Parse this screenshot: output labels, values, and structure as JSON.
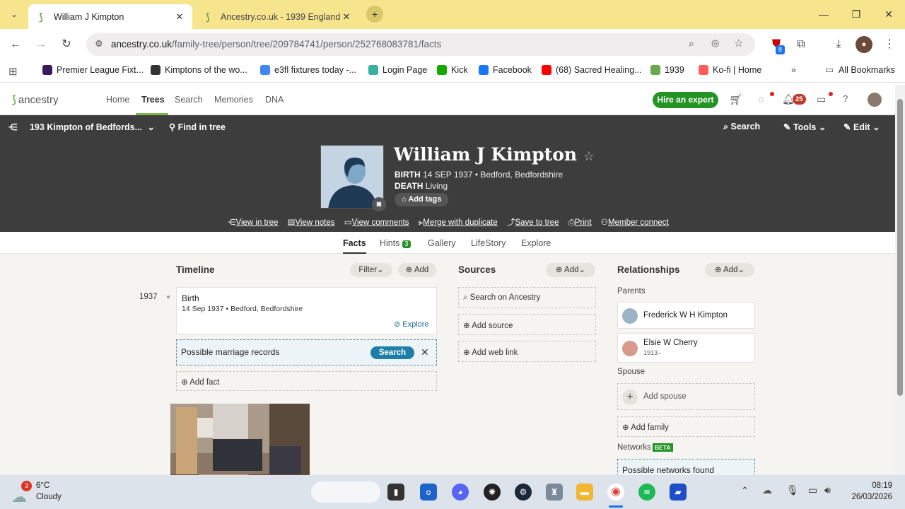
{
  "browser": {
    "tabs": [
      {
        "title": "William J Kimpton",
        "active": true
      },
      {
        "title": "Ancestry.co.uk - 1939 England &",
        "active": false
      }
    ],
    "url_domain": "ancestry.co.uk",
    "url_path": "/family-tree/person/tree/209784741/person/252768083781/facts",
    "extension_badge": "8",
    "bookmarks": [
      {
        "label": "Premier League Fixt...",
        "icon": "premier-league-icon",
        "color": "#3d195b"
      },
      {
        "label": "Kimptons of the wo...",
        "icon": "globe-icon",
        "color": "#333333"
      },
      {
        "label": "e3fl fixtures today -...",
        "icon": "google-icon",
        "color": "#4285f4"
      },
      {
        "label": "Login Page",
        "icon": "login-icon",
        "color": "#3ab0a0"
      },
      {
        "label": "Kick",
        "icon": "kick-icon",
        "color": "#14a800"
      },
      {
        "label": "Facebook",
        "icon": "facebook-icon",
        "color": "#1877f2"
      },
      {
        "label": "(68) Sacred Healing...",
        "icon": "youtube-icon",
        "color": "#ff0000"
      },
      {
        "label": "1939",
        "icon": "ancestry-leaf-icon",
        "color": "#6aa84f"
      },
      {
        "label": "Ko-fi | Home",
        "icon": "kofi-icon",
        "color": "#ff5e5b"
      }
    ],
    "all_bookmarks": "All Bookmarks"
  },
  "ancestry_nav": {
    "logo": "ancestry",
    "links": [
      "Home",
      "Trees",
      "Search",
      "Memories",
      "DNA"
    ],
    "active": "Trees",
    "hire": "Hire an expert",
    "notification_count": "25"
  },
  "person_header": {
    "tree_name": "193 Kimpton of Bedfords...",
    "find_in_tree": "Find in tree",
    "search": "Search",
    "tools": "Tools",
    "edit": "Edit",
    "name": "William J Kimpton",
    "birth_label": "BIRTH",
    "birth_value": "14 SEP 1937 • Bedford, Bedfordshire",
    "death_label": "DEATH",
    "death_value": "Living",
    "add_tags": "Add tags",
    "actions": [
      "View in tree",
      "View notes",
      "View comments",
      "Merge with duplicate",
      "Save to tree",
      "Print",
      "Member connect"
    ]
  },
  "person_tabs": {
    "facts": "Facts",
    "hints": "Hints",
    "hints_count": "3",
    "gallery": "Gallery",
    "lifestory": "LifeStory",
    "explore": "Explore"
  },
  "timeline": {
    "title": "Timeline",
    "filter": "Filter",
    "add": "Add",
    "year": "1937",
    "event_title": "Birth",
    "event_detail": "14 Sep 1937 • Bedford, Bedfordshire",
    "explore": "Explore",
    "hint_text": "Possible marriage records",
    "hint_search": "Search",
    "add_fact": "Add fact"
  },
  "sources": {
    "title": "Sources",
    "add": "Add",
    "search_on": "Search on Ancestry",
    "add_source": "Add source",
    "add_web_link": "Add web link"
  },
  "relationships": {
    "title": "Relationships",
    "add": "Add",
    "parents_label": "Parents",
    "father": "Frederick W H Kimpton",
    "mother": "Elsie W Cherry",
    "mother_dates": "1913–",
    "spouse_label": "Spouse",
    "add_spouse": "Add spouse",
    "add_family": "Add family",
    "networks_label": "Networks",
    "beta": "BETA",
    "networks_found": "Possible networks found"
  },
  "taskbar": {
    "weather_temp": "6°C",
    "weather_desc": "Cloudy",
    "weather_badge": "3",
    "time": "08:19",
    "date": "26/03/2026"
  }
}
